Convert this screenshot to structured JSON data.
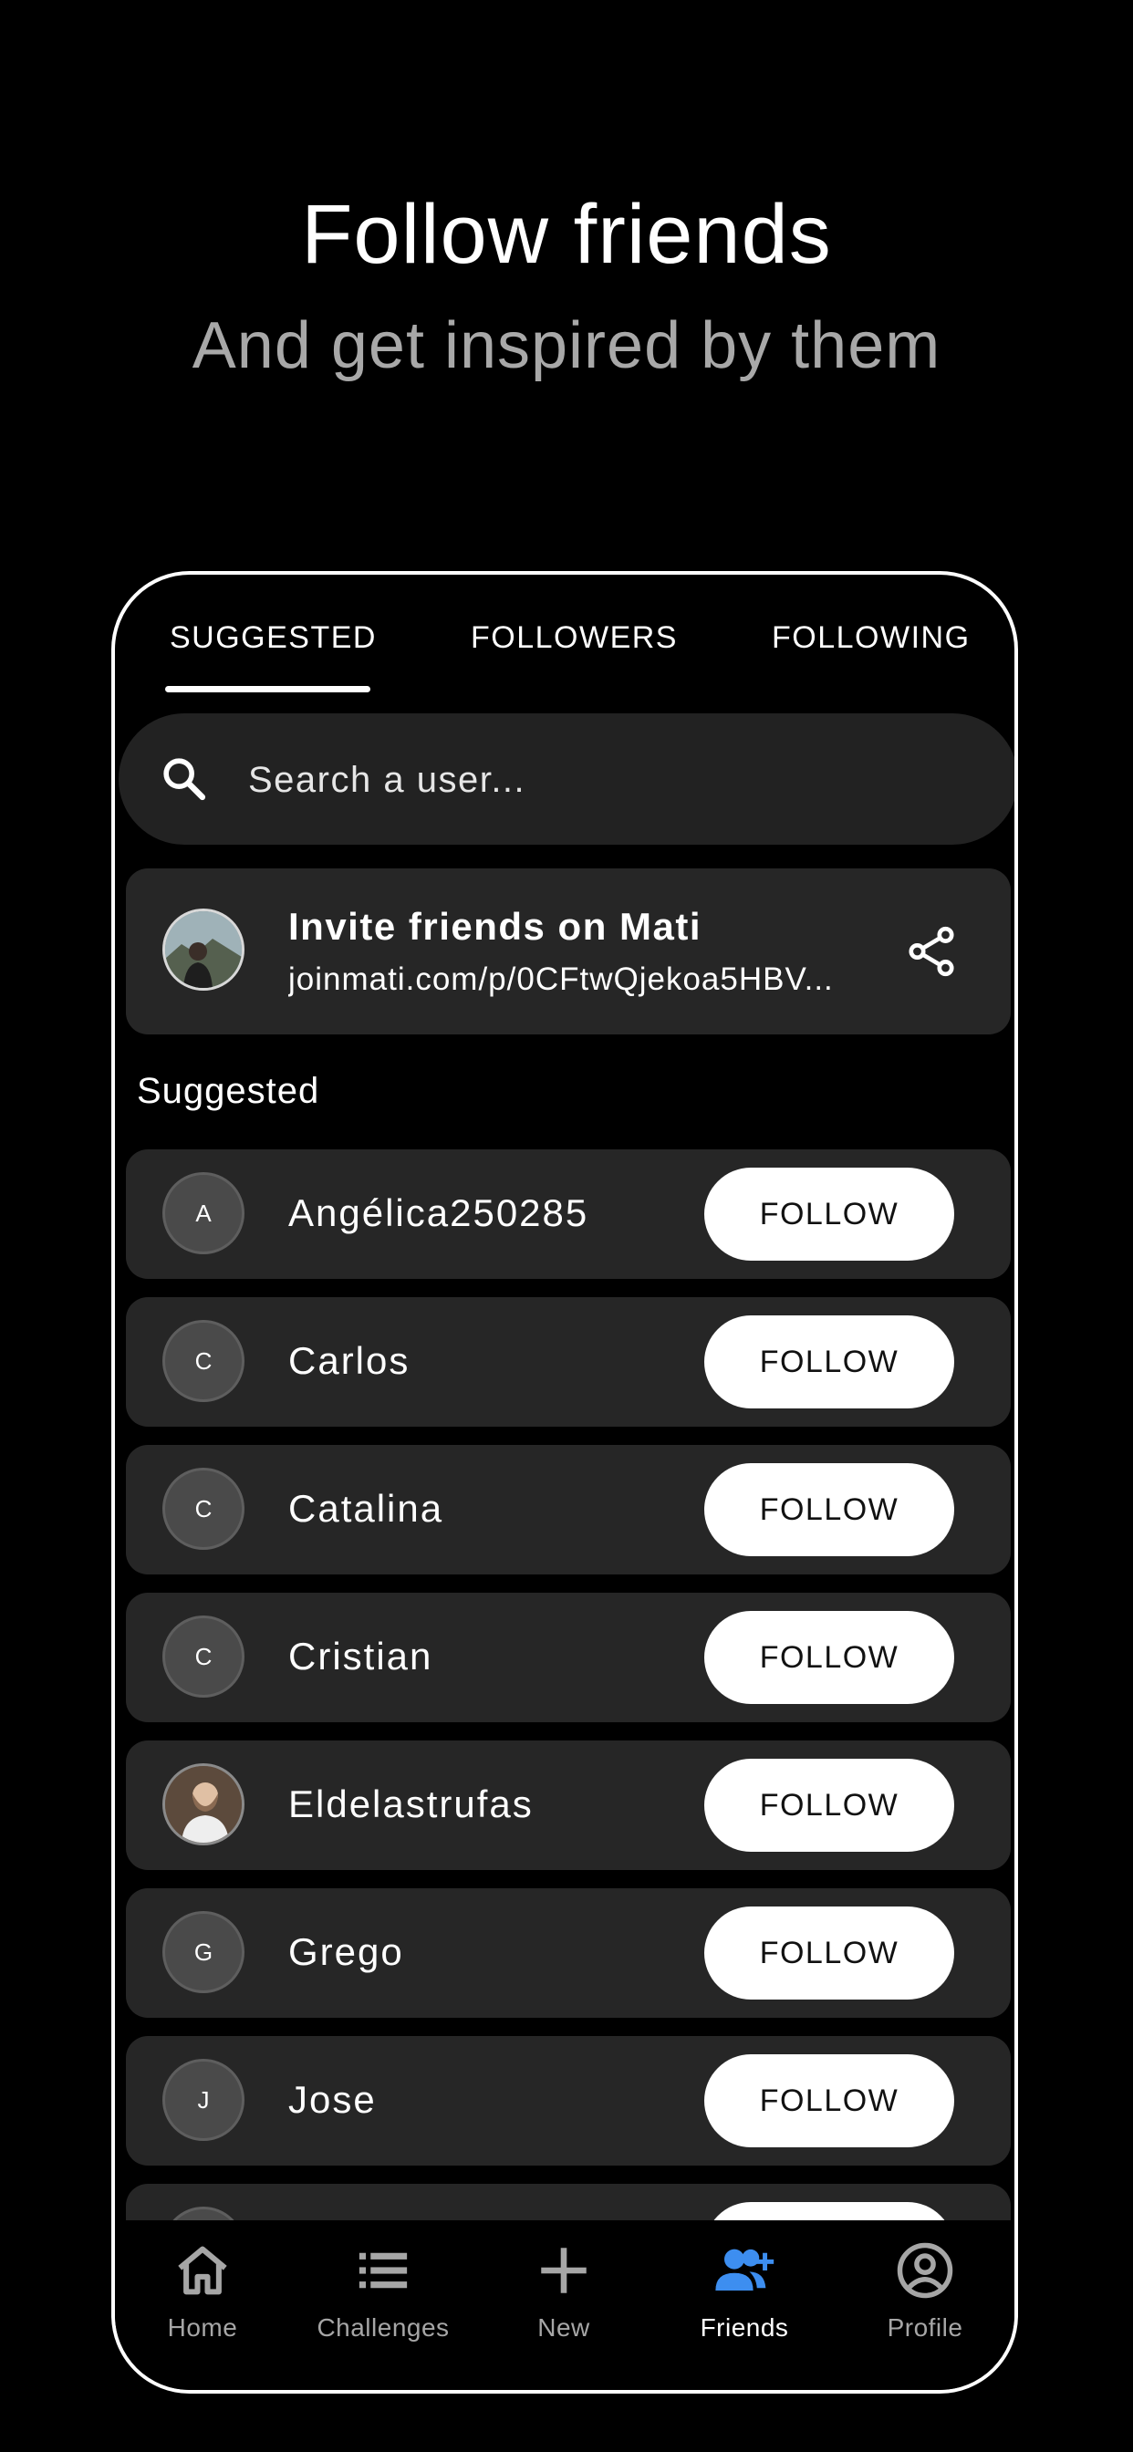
{
  "hero": {
    "title": "Follow friends",
    "subtitle": "And get inspired by them"
  },
  "tabs": [
    {
      "label": "SUGGESTED",
      "active": true
    },
    {
      "label": "FOLLOWERS",
      "active": false
    },
    {
      "label": "FOLLOWING",
      "active": false
    }
  ],
  "search": {
    "placeholder": "Search a user...",
    "icon": "search-icon"
  },
  "invite": {
    "title": "Invite friends on Mati",
    "link": "joinmati.com/p/0CFtwQjekoa5HBV...",
    "icon": "share-icon"
  },
  "suggested": {
    "label": "Suggested",
    "follow_label": "FOLLOW",
    "users": [
      {
        "initial": "A",
        "name": "Angélica250285",
        "photo": false
      },
      {
        "initial": "C",
        "name": "Carlos",
        "photo": false
      },
      {
        "initial": "C",
        "name": "Catalina",
        "photo": false
      },
      {
        "initial": "C",
        "name": "Cristian",
        "photo": false
      },
      {
        "initial": "",
        "name": "Eldelastrufas",
        "photo": true
      },
      {
        "initial": "G",
        "name": "Grego",
        "photo": false
      },
      {
        "initial": "J",
        "name": "Jose",
        "photo": false
      }
    ]
  },
  "nav": [
    {
      "label": "Home",
      "icon": "home-icon",
      "active": false
    },
    {
      "label": "Challenges",
      "icon": "list-icon",
      "active": false
    },
    {
      "label": "New",
      "icon": "plus-icon",
      "active": false
    },
    {
      "label": "Friends",
      "icon": "add-friend-icon",
      "active": true
    },
    {
      "label": "Profile",
      "icon": "profile-icon",
      "active": false
    }
  ],
  "colors": {
    "background": "#000000",
    "card": "#262626",
    "accent": "#3d8ef0",
    "muted": "#a6a6a6"
  }
}
